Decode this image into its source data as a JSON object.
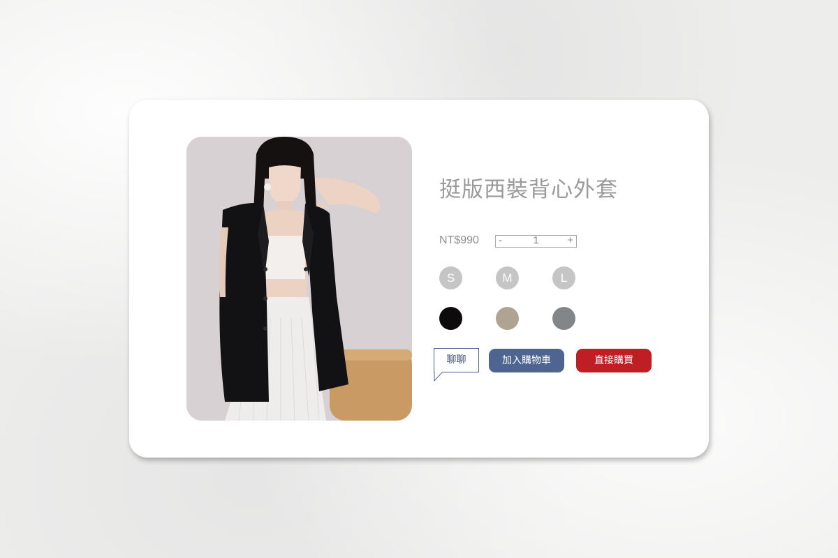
{
  "product": {
    "title": "挺版西裝背心外套",
    "price": "NT$990",
    "image_alt": "product-photo"
  },
  "quantity": {
    "minus_label": "-",
    "value": "1",
    "plus_label": "+"
  },
  "sizes": [
    {
      "label": "S"
    },
    {
      "label": "M"
    },
    {
      "label": "L"
    }
  ],
  "colors": [
    {
      "name": "black",
      "hex": "#0d0b0b"
    },
    {
      "name": "khaki",
      "hex": "#aea491"
    },
    {
      "name": "gray",
      "hex": "#828688"
    }
  ],
  "actions": {
    "chat_label": "聊聊",
    "add_to_cart_label": "加入購物車",
    "buy_now_label": "直接購買"
  },
  "theme": {
    "cart_color": "#4e6591",
    "buy_color": "#be1e24",
    "chat_border": "#4a5f8c"
  }
}
